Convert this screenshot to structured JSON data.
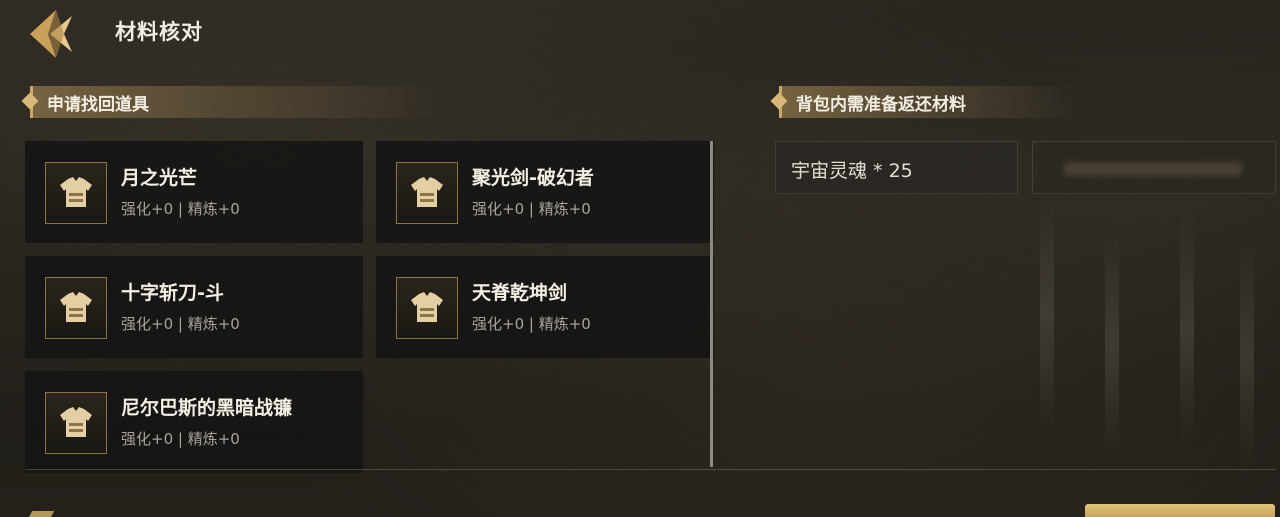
{
  "header": {
    "title": "材料核对",
    "back_icon": "back-arrow-icon"
  },
  "left_section": {
    "title": "申请找回道具",
    "items": [
      {
        "name": "月之光芒",
        "stats": "强化+0 | 精炼+0",
        "icon": "armor-icon"
      },
      {
        "name": "聚光剑-破幻者",
        "stats": "强化+0 | 精炼+0",
        "icon": "armor-icon"
      },
      {
        "name": "十字斩刀-斗",
        "stats": "强化+0 | 精炼+0",
        "icon": "armor-icon"
      },
      {
        "name": "天脊乾坤剑",
        "stats": "强化+0 | 精炼+0",
        "icon": "armor-icon"
      },
      {
        "name": "尼尔巴斯的黑暗战镰",
        "stats": "强化+0 | 精炼+0",
        "icon": "armor-icon"
      }
    ]
  },
  "right_section": {
    "title": "背包内需准备返还材料",
    "materials": [
      {
        "label": "宇宙灵魂 * 25"
      }
    ]
  },
  "colors": {
    "accent_gold": "#c9a868",
    "card_bg": "#161513",
    "stat_text": "#a7a39a"
  }
}
